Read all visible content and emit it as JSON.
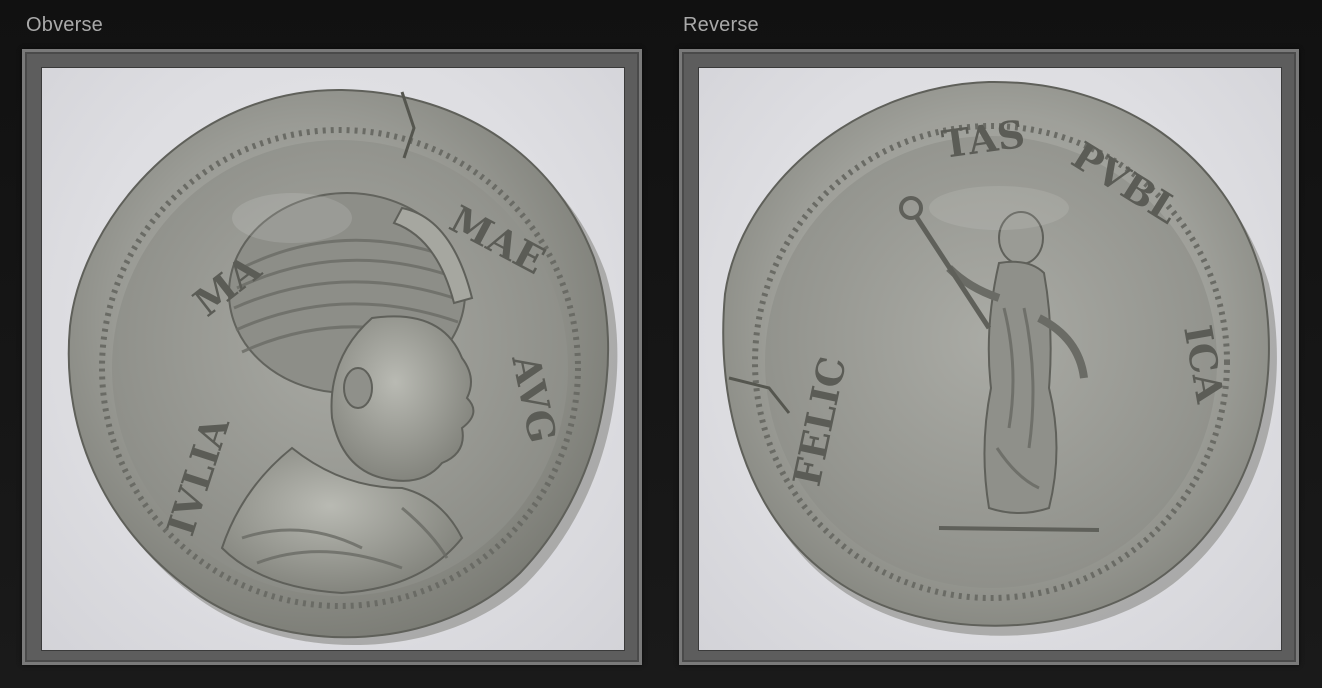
{
  "panels": {
    "obverse": {
      "label": "Obverse"
    },
    "reverse": {
      "label": "Reverse"
    }
  },
  "colors": {
    "background": "#141414",
    "frame": "#5d5d5d",
    "frame_border": "#7a7a7a",
    "label_text": "#a9a9a9",
    "photo_background": "#e2e2e6",
    "coin_silver": "#9c9d98"
  }
}
